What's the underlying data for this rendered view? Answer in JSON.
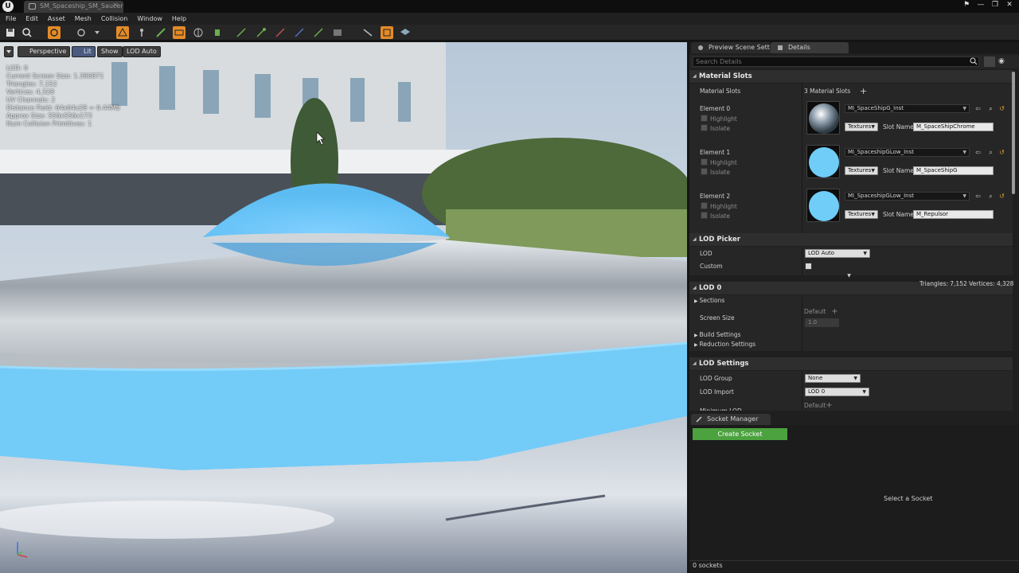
{
  "window": {
    "tab_title": "SM_Spaceship_SM_Saucer",
    "logo_letter": "U",
    "controls": [
      "⚑",
      "—",
      "❐",
      "✕"
    ]
  },
  "menu": [
    "File",
    "Edit",
    "Asset",
    "Mesh",
    "Collision",
    "Window",
    "Help"
  ],
  "viewport": {
    "buttons": {
      "perspective": "Perspective",
      "lit": "Lit",
      "show": "Show",
      "lod": "LOD Auto"
    },
    "stats": [
      "LOD:  0",
      "Current Screen Size:  1.390871",
      "Triangles:  7,152",
      "Vertices:  4,328",
      "UV Channels:  2",
      "Distance Field:  64x64x28 = 0.44Mb",
      "Approx Size: 556x556x173",
      "Num Collision Primitives:  1"
    ]
  },
  "panel": {
    "tabs": {
      "preview": "Preview Scene Sett",
      "details": "Details"
    },
    "search_placeholder": "Search Details",
    "material_slots": {
      "category": "Material Slots",
      "label": "Material Slots",
      "count": "3 Material Slots",
      "elements": [
        {
          "name": "Element 0",
          "highlight": "Highlight",
          "isolate": "Isolate",
          "material": "MI_SpaceShipG_Inst",
          "textures": "Textures",
          "slot_label": "Slot Name",
          "slot": "M_SpaceShipChrome"
        },
        {
          "name": "Element 1",
          "highlight": "Highlight",
          "isolate": "Isolate",
          "material": "MI_SpaceshipGLow_Inst",
          "textures": "Textures",
          "slot_label": "Slot Name",
          "slot": "M_SpaceShipG"
        },
        {
          "name": "Element 2",
          "highlight": "Highlight",
          "isolate": "Isolate",
          "material": "MI_SpaceshipGLow_Inst",
          "textures": "Textures",
          "slot_label": "Slot Name",
          "slot": "M_Repulsor"
        }
      ]
    },
    "lod_picker": {
      "category": "LOD Picker",
      "lod_label": "LOD",
      "lod_value": "LOD Auto",
      "custom_label": "Custom"
    },
    "lod0": {
      "category": "LOD 0",
      "stats": "Triangles: 7,152   Vertices: 4,328",
      "sections": "Sections",
      "screen_size_label": "Screen Size",
      "screen_size_default": "Default",
      "screen_size_value": "1.0",
      "build_settings": "Build Settings",
      "reduction_settings": "Reduction Settings"
    },
    "lod_settings": {
      "category": "LOD Settings",
      "lod_group_label": "LOD Group",
      "lod_group_value": "None",
      "lod_import_label": "LOD Import",
      "lod_import_value": "LOD 0",
      "minimum_lod_label": "Minimum LOD",
      "minimum_lod_default": "Default"
    }
  },
  "socket_manager": {
    "tab": "Socket Manager",
    "create_button": "Create Socket",
    "empty_message": "Select a Socket",
    "count": "0 sockets"
  }
}
